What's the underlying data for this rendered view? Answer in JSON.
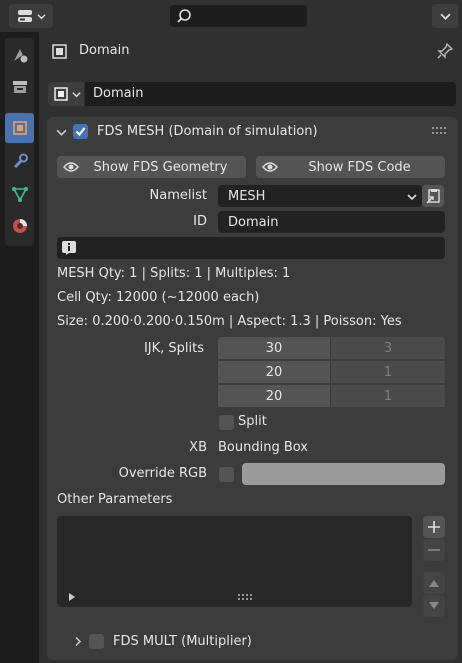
{
  "topbar": {
    "editor_icon": "properties-editor-icon",
    "search_placeholder": "",
    "menu_icon": "chevron-down-icon"
  },
  "property_tabs": [
    {
      "name": "tool",
      "active": false
    },
    {
      "name": "render",
      "active": false
    },
    {
      "name": "object",
      "active": true
    },
    {
      "name": "modifiers",
      "active": false
    },
    {
      "name": "data",
      "active": false
    },
    {
      "name": "material",
      "active": false
    }
  ],
  "header": {
    "title": "Domain"
  },
  "datablock": {
    "name": "Domain"
  },
  "panel_mesh": {
    "title": "FDS MESH (Domain of simulation)",
    "enabled": true,
    "show_geometry_label": "Show FDS Geometry",
    "show_code_label": "Show FDS Code",
    "namelist_label": "Namelist",
    "namelist_value": "MESH",
    "id_label": "ID",
    "id_value": "Domain",
    "info_text": "",
    "stats": [
      "MESH Qty: 1 | Splits: 1 | Multiples: 1",
      "Cell Qty: 12000 (~12000 each)",
      "Size: 0.200·0.200·0.150m | Aspect: 1.3 | Poisson: Yes"
    ],
    "ijk_label": "IJK, Splits",
    "ijk": [
      {
        "value": "30",
        "split": "3"
      },
      {
        "value": "20",
        "split": "1"
      },
      {
        "value": "20",
        "split": "1"
      }
    ],
    "split_label": "Split",
    "split_checked": false,
    "xb_label": "XB",
    "xb_value": "Bounding Box",
    "override_rgb_label": "Override RGB",
    "override_rgb_checked": false,
    "override_rgb_color": "#9a9a9a",
    "other_params_label": "Other Parameters"
  },
  "panel_mult": {
    "title": "FDS MULT (Multiplier)",
    "enabled": false
  },
  "colors": {
    "accent": "#4772b3",
    "panel_bg": "#3c3c3c",
    "field_bg": "#222222",
    "button_bg": "#545454"
  }
}
